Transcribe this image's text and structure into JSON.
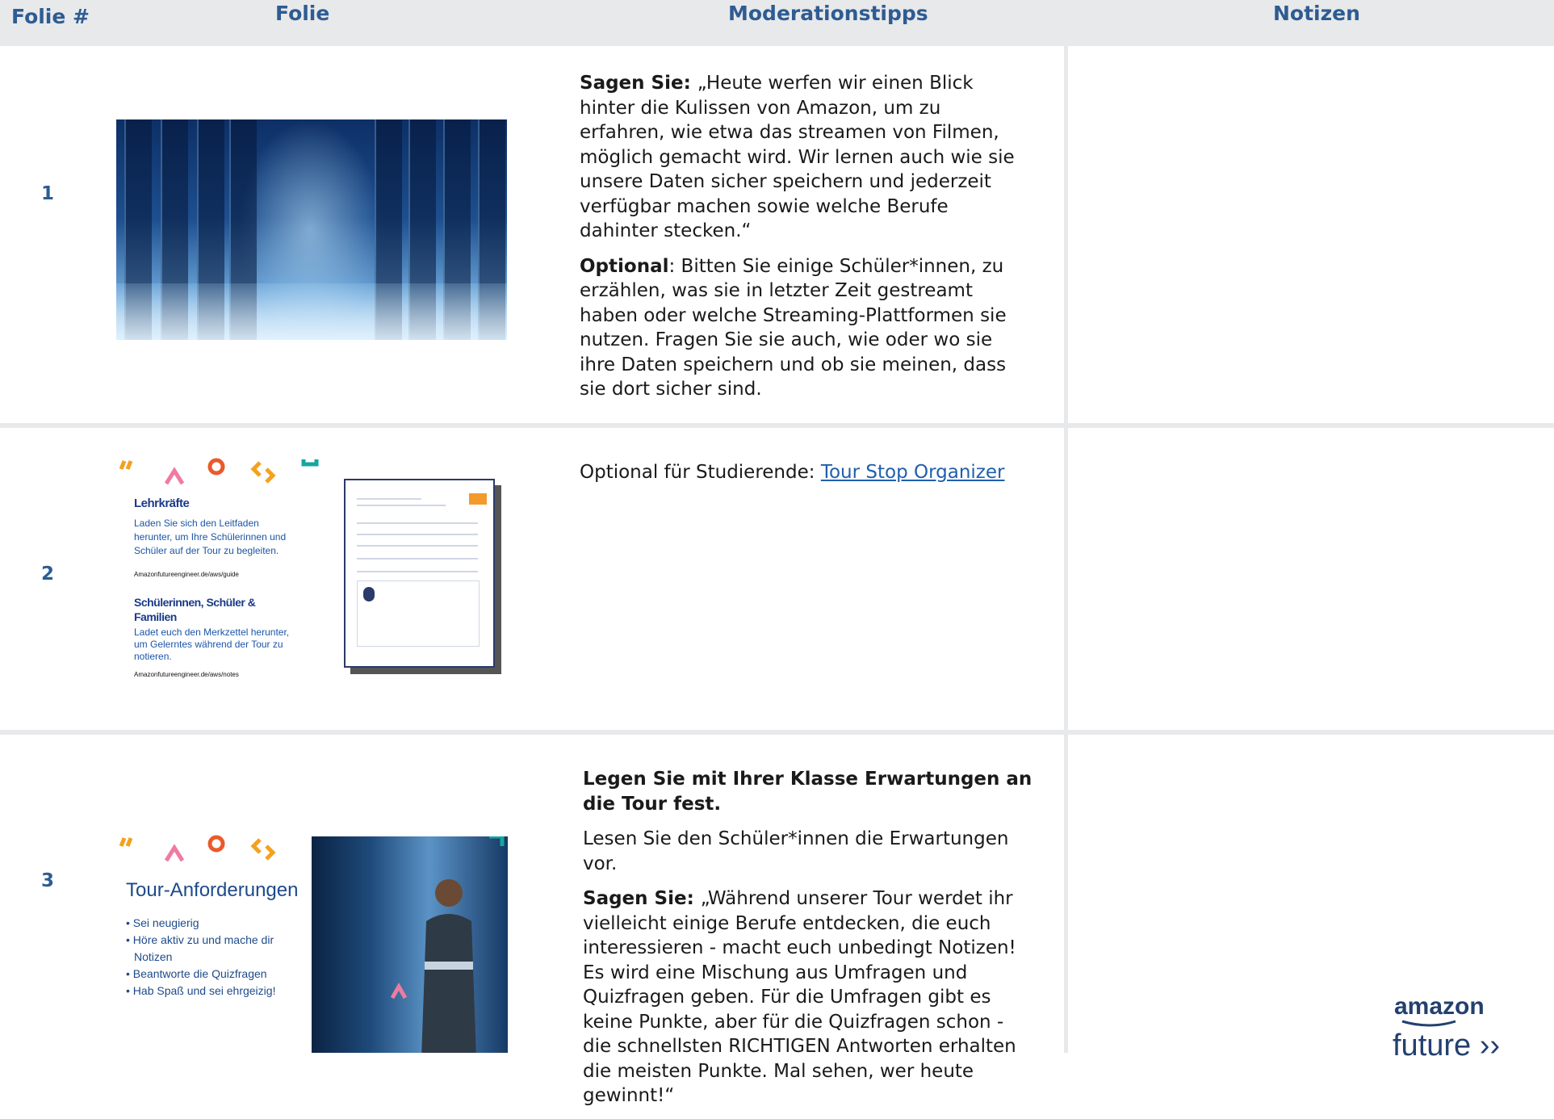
{
  "header": {
    "col_num": "Folie #",
    "col_slide": "Folie",
    "col_tips": "Moderationstipps",
    "col_notes": "Notizen"
  },
  "rows": [
    {
      "number": "1",
      "paragraphs": [
        {
          "bold": "Sagen Sie: ",
          "text": "„Heute werfen wir einen Blick hinter die Kulissen von Amazon, um zu erfahren, wie etwa das streamen von Filmen, möglich gemacht wird. Wir lernen auch wie sie unsere Daten sicher speichern und jederzeit verfügbar machen sowie welche Berufe dahinter stecken.“"
        },
        {
          "bold": "Optional",
          "text": ": Bitten Sie einige Schüler*innen, zu erzählen, was sie in letzter Zeit gestreamt haben oder welche Streaming-Plattformen sie nutzen. Fragen Sie sie auch, wie oder wo sie ihre Daten speichern und ob sie meinen, dass sie dort sicher sind."
        }
      ]
    },
    {
      "number": "2",
      "text": "Optional für Studierende: ",
      "link": "Tour Stop Organizer",
      "slide": {
        "heading1": "Lehrkräfte",
        "body1": "Laden Sie sich den Leitfaden herunter, um Ihre Schülerinnen und Schüler auf der Tour zu begleiten.",
        "url1": "Amazonfutureengineer.de/aws/guide",
        "heading2": "Schülerinnen, Schüler & Familien",
        "body2": "Ladet euch den Merkzettel herunter, um Gelerntes während der Tour zu notieren.",
        "url2": "Amazonfutureengineer.de/aws/notes"
      }
    },
    {
      "number": "3",
      "heading": "Legen Sie mit Ihrer Klasse Erwartungen an die Tour fest.",
      "line": "Lesen Sie den Schüler*innen die Erwartungen vor.",
      "say_bold": "Sagen Sie: ",
      "say_text": "„Während unserer Tour werdet ihr vielleicht einige Berufe entdecken, die euch interessieren - macht euch unbedingt Notizen! Es wird eine Mischung aus Umfragen und Quizfragen geben. Für die Umfragen gibt es keine Punkte, aber für die Quizfragen schon - die schnellsten RICHTIGEN Antworten erhalten die meisten Punkte. Mal sehen, wer heute gewinnt!“",
      "slide": {
        "title": "Tour-Anforderungen",
        "items": [
          "Sei neugierig",
          "Höre aktiv zu und mache dir Notizen",
          "Beantworte die Quizfragen",
          "Hab Spaß und sei ehrgeizig!"
        ]
      }
    }
  ],
  "logo": {
    "top": "amazon",
    "bottom": "future"
  }
}
